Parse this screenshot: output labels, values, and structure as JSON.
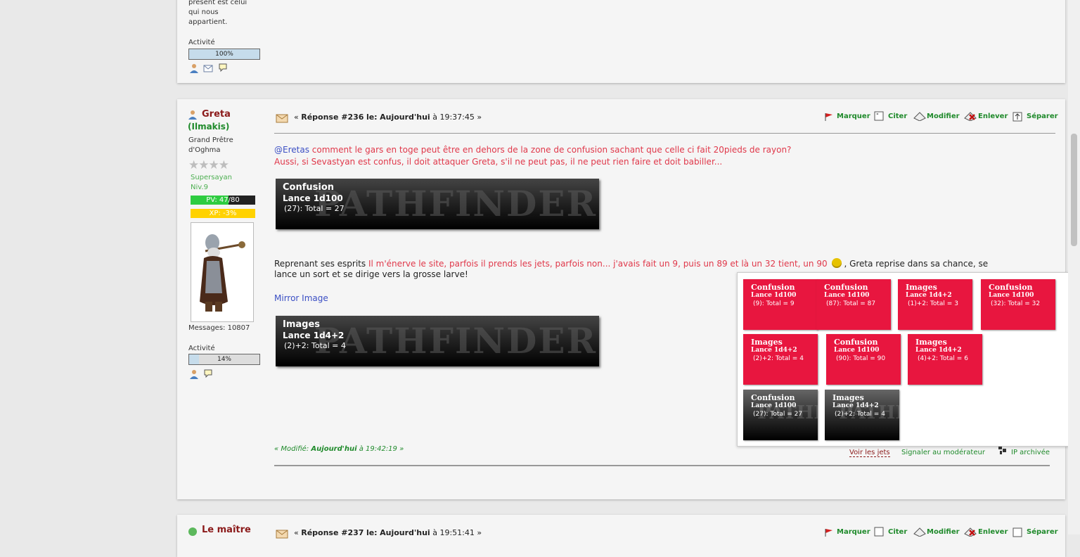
{
  "prev_post": {
    "signature_lines": [
      "présent est celui",
      "qui nous",
      "appartient."
    ],
    "activity_label": "Activité",
    "activity_percent_text": "100%",
    "activity_fraction": 1.0
  },
  "post": {
    "author_name": "Greta",
    "author_sub": "(Ilmakis)",
    "rank_lines": [
      "Grand Prêtre",
      "d'Oghma"
    ],
    "custom_title": "Supersayan",
    "level": "Niv.9",
    "pv_label_a": "PV: 47",
    "pv_label_b": "/80",
    "xp_label": "XP: -3%",
    "messages": "Messages: 10807",
    "activity_label": "Activité",
    "activity_percent_text": "14%",
    "activity_fraction": 0.14,
    "header_prefix": "«",
    "reply_label": "Réponse #236",
    "header_le": "le:",
    "header_date": "Aujourd'hui",
    "header_time": "à 19:37:45 »",
    "actions": [
      "Marquer",
      "Citer",
      "Modifier",
      "Enlever",
      "Séparer"
    ],
    "line1_mention": "@Eretas",
    "line1_text": " comment le gars en toge peut être en dehors de la zone de confusion sachant que celle ci fait 20pieds de rayon?",
    "line2_text": "Aussi, si Sevastyan est confus, il doit attaquer Greta, s'il ne peut pas, il ne peut rien faire et doit babiller...",
    "roll1": {
      "title": "Confusion",
      "dice": "Lance 1d100",
      "result": "(27): Total = 27"
    },
    "para_black_start": "Reprenant ses esprits ",
    "para_red": "Il m'énerve le site, parfois il prends les jets, parfois non... j'avais fait un 9, puis un 89 et là un 32 tient, un 90",
    "para_black_end": ", Greta reprise dans sa chance, se",
    "para_line2": "lance un sort et se dirige vers la grosse larve!",
    "mirror_link": "Mirror Image",
    "roll2": {
      "title": "Images",
      "dice": "Lance 1d4+2",
      "result": "(2)+2: Total = 4"
    },
    "watermark": "PATHFINDER",
    "modified_prefix": "« Modifié:",
    "modified_date": "Aujourd'hui",
    "modified_time": "à 19:42:19 »",
    "footer_view_rolls": "Voir les jets",
    "footer_report": "Signaler au modérateur",
    "footer_ip": "IP archivée"
  },
  "popup_rolls": [
    {
      "title": "Confusion",
      "dice": "Lance 1d100",
      "result": "(9): Total = 9",
      "style": "red"
    },
    {
      "title": "Confusion",
      "dice": "Lance 1d100",
      "result": "(87): Total = 87",
      "style": "red"
    },
    {
      "title": "Images",
      "dice": "Lance 1d4+2",
      "result": "(1)+2: Total = 3",
      "style": "red"
    },
    {
      "title": "Confusion",
      "dice": "Lance 1d100",
      "result": "(32): Total = 32",
      "style": "red"
    },
    {
      "title": "Images",
      "dice": "Lance 1d4+2",
      "result": "(2)+2: Total = 4",
      "style": "red"
    },
    {
      "title": "Confusion",
      "dice": "Lance 1d100",
      "result": "(90): Total = 90",
      "style": "red"
    },
    {
      "title": "Images",
      "dice": "Lance 1d4+2",
      "result": "(4)+2: Total = 6",
      "style": "red"
    },
    {
      "title": "Confusion",
      "dice": "Lance 1d100",
      "result": "(27): Total = 27",
      "style": "dark"
    },
    {
      "title": "Images",
      "dice": "Lance 1d4+2",
      "result": "(2)+2: Total = 4",
      "style": "dark"
    }
  ],
  "next_post": {
    "author_name": "Le maître",
    "header_prefix": "«",
    "reply_label": "Réponse #237",
    "header_le": "le:",
    "header_date": "Aujourd'hui",
    "header_time": "à 19:51:41 »",
    "actions": [
      "Marquer",
      "Citer",
      "Modifier",
      "Enlever",
      "Séparer"
    ]
  },
  "colors": {
    "accent_green": "#1f8a2b",
    "author_red": "#8b1a1a",
    "text_red": "#e0384a",
    "link_blue": "#3b4fc4",
    "tile_red": "#e8163f",
    "pv_green": "#2ecc40",
    "xp_yellow": "#ffd200"
  }
}
